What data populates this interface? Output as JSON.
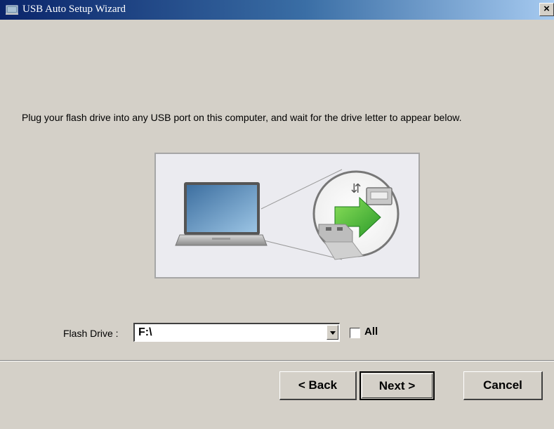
{
  "window": {
    "title": "USB Auto Setup Wizard",
    "close_label": "×"
  },
  "main": {
    "instruction": "Plug your flash drive into any USB port on this computer, and wait for the drive letter to appear below."
  },
  "form": {
    "flash_drive_label": "Flash Drive :",
    "flash_drive_value": "F:\\",
    "all_label": "All",
    "all_checked": false
  },
  "buttons": {
    "back": "< Back",
    "next": "Next >",
    "cancel": "Cancel"
  },
  "colors": {
    "titlebar_start": "#0a246a",
    "titlebar_end": "#a6caf0",
    "arrow_green": "#3cb43c"
  }
}
